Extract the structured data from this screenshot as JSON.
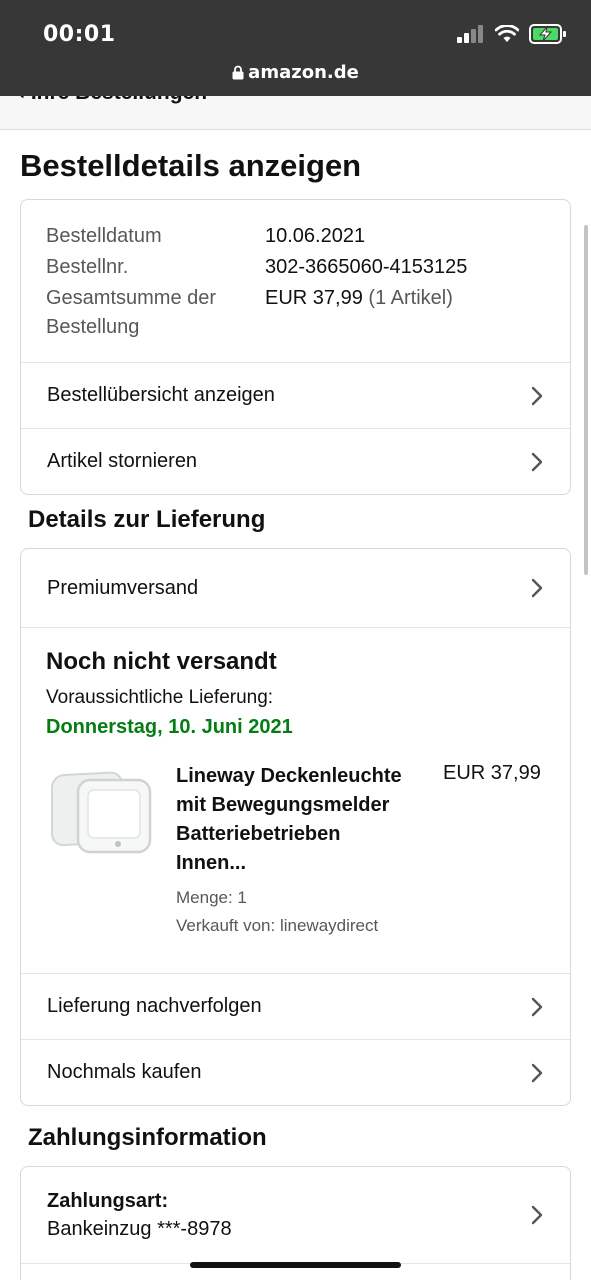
{
  "status_bar": {
    "time": "00:01",
    "url": "amazon.de"
  },
  "nav": {
    "back_label": "Ihre Bestellungen"
  },
  "page_title": "Bestelldetails anzeigen",
  "order_info": {
    "rows": [
      {
        "label": "Bestelldatum",
        "value": "10.06.2021"
      },
      {
        "label": "Bestellnr.",
        "value": "302-3665060-4153125"
      }
    ],
    "total_label_1": "Gesamtsumme der",
    "total_label_2": "Bestellung",
    "total_value": "EUR 37,99",
    "total_count": "(1 Artikel)"
  },
  "order_links": [
    {
      "label": "Bestellübersicht anzeigen"
    },
    {
      "label": "Artikel stornieren"
    }
  ],
  "delivery": {
    "section_title": "Details zur Lieferung",
    "shipping_speed": "Premiumversand",
    "status": "Noch nicht versandt",
    "eta_label": "Voraussichtliche Lieferung:",
    "eta_date": "Donnerstag, 10. Juni 2021",
    "product": {
      "title_lines": [
        "Lineway Deckenleuchte",
        "mit Bewegungsmelder",
        "Batteriebetrieben",
        "Innen..."
      ],
      "price": "EUR 37,99",
      "quantity": "Menge: 1",
      "seller": "Verkauft von: linewaydirect"
    },
    "links": [
      {
        "label": "Lieferung nachverfolgen"
      },
      {
        "label": "Nochmals kaufen"
      }
    ]
  },
  "payment": {
    "section_title": "Zahlungsinformation",
    "method_label": "Zahlungsart:",
    "method_value": "Bankeinzug ***-8978"
  },
  "colors": {
    "accent_green": "#067d14",
    "status_bar": "#373737",
    "battery_green": "#4cd964"
  }
}
